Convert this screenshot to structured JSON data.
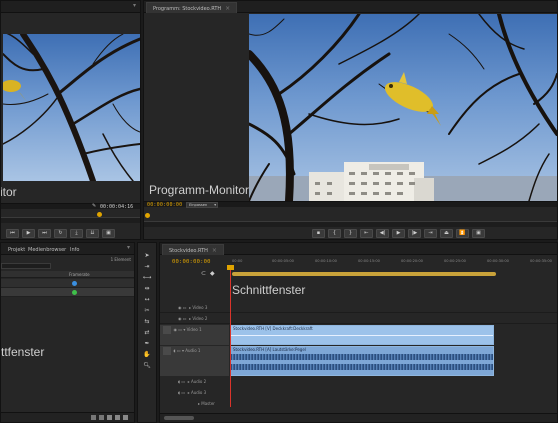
{
  "source_monitor": {
    "label": "itor",
    "timecode": "00:00:04:16"
  },
  "program_monitor": {
    "tab": "Programm: Stockvideo.RTH",
    "label": "Programm-Monitor",
    "timecode": "00:00:00:00",
    "fit": "Einpassen"
  },
  "project_panel": {
    "tabs": [
      "Projekt",
      "Medienbrowser",
      "Info"
    ],
    "items_count": "1 Element",
    "column_header": "Framerate",
    "label": "ttfenster",
    "rows": [
      {
        "icon_color": "#3a8fe0"
      },
      {
        "icon_color": "#3fbf4a"
      }
    ]
  },
  "timeline": {
    "tab": "Stockvideo.RTH",
    "timecode": "00:00:00:00",
    "label": "Schnittfenster",
    "ruler": [
      "00:00",
      "00:00:05:00",
      "00:00:10:00",
      "00:00:15:00",
      "00:00:20:00",
      "00:00:25:00",
      "00:00:30:00",
      "00:00:35:00"
    ],
    "video_tracks": [
      "Video 3",
      "Video 2",
      "Video 1"
    ],
    "audio_tracks": [
      "Audio 1",
      "Audio 2",
      "Audio 3",
      "Master"
    ],
    "video_clip_label": "Stockvideo.RTH [V]  Deckkraft:Deckkraft",
    "audio_clip_label": "Stockvideo.RTH [A]  Lautstärke:Pegel"
  },
  "colors": {
    "timecode": "#e0a400",
    "clip": "#9cc2ea",
    "playhead": "#d9342b"
  }
}
